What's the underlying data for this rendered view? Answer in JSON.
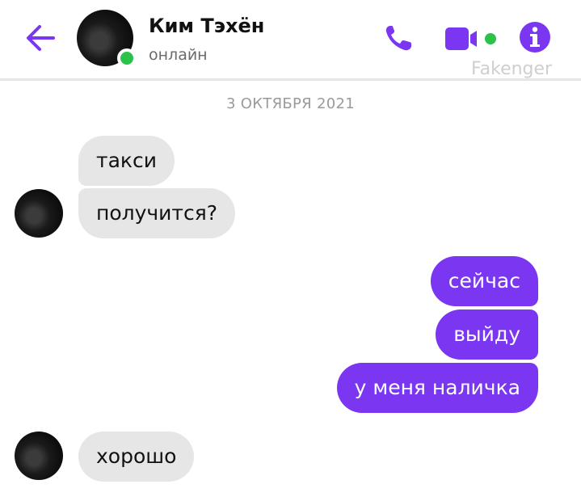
{
  "header": {
    "contact_name": "Ким Тэхён",
    "status": "онлайн",
    "watermark": "Fakenger",
    "icons": {
      "back": "arrow-left-icon",
      "call": "phone-icon",
      "video": "video-camera-icon",
      "info": "info-icon"
    },
    "accent_color": "#7a36f0",
    "online_color": "#2bc24a"
  },
  "chat": {
    "date": "3 ОКТЯБРЯ 2021",
    "messages": [
      {
        "direction": "incoming",
        "text": "такси"
      },
      {
        "direction": "incoming",
        "text": "получится?"
      },
      {
        "direction": "outgoing",
        "text": "сейчас"
      },
      {
        "direction": "outgoing",
        "text": "выйду"
      },
      {
        "direction": "outgoing",
        "text": "у меня наличка"
      },
      {
        "direction": "incoming",
        "text": "хорошо"
      }
    ],
    "incoming_bubble_color": "#e6e6e6",
    "outgoing_bubble_color": "#7a36f0"
  }
}
